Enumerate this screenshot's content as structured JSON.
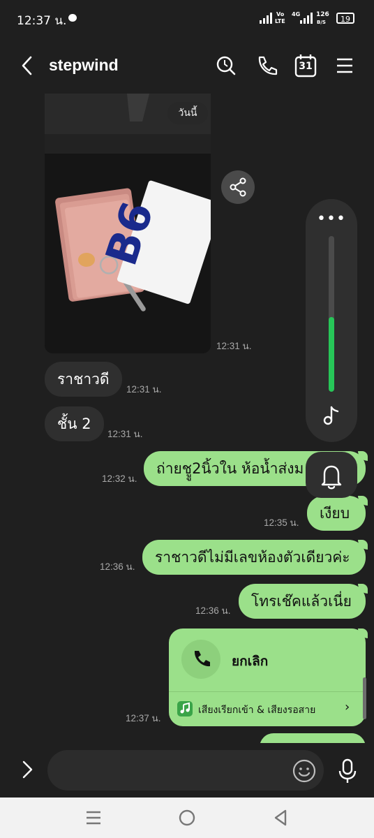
{
  "status_bar": {
    "time": "12:37 น.",
    "net_top": "Vo",
    "net_bottom": "LTE",
    "net_4g": "4G",
    "speed_value": "126",
    "speed_unit": "B/S",
    "battery": "19"
  },
  "header": {
    "title": "stepwind"
  },
  "calendar_day": "31",
  "date_label": "วันนี้",
  "messages": [
    {
      "time": "12:31 น."
    },
    {
      "text": "ราชาวดี",
      "time": "12:31 น."
    },
    {
      "text": "ชั้น 2",
      "time": "12:31 น."
    },
    {
      "text": "ถ่ายชูู2นิ้วใน ห้อน้ำส่งม",
      "time": "12:32 น."
    },
    {
      "text": "เงียบ",
      "time": "12:35 น."
    },
    {
      "text": "ราชาวดีไม่มีเลขห้องตัวเดียวค่ะ",
      "time": "12:36 น."
    },
    {
      "text": "โทรเช๊คแล้วเนี่ย",
      "time": "12:36 น."
    }
  ],
  "call_card": {
    "label": "ยกเลิก",
    "ringtone_label": "เสียงเรียกเข้า & เสียงรอสาย",
    "time": "12:37 น."
  },
  "photo_tag": "B6",
  "volume": {
    "level": 0.48,
    "menu": "•••"
  },
  "input": {
    "placeholder": ""
  },
  "colors": {
    "outgoing_bubble": "#9be08a",
    "incoming_bubble": "#2f2f2f",
    "background": "#1f1f1f",
    "volume_fill": "#27c658"
  }
}
